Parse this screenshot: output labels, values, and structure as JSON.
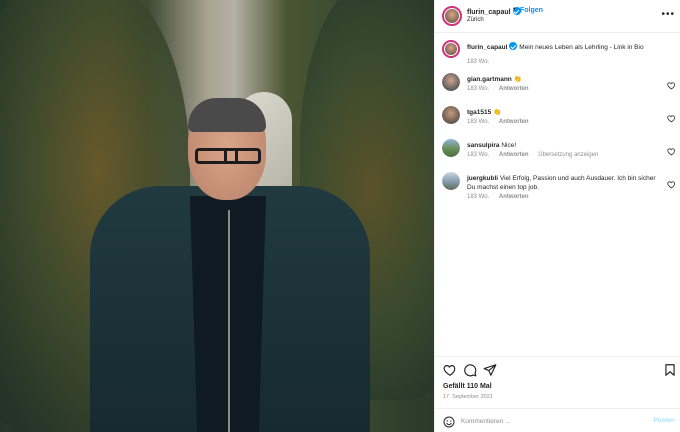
{
  "post": {
    "username": "flurin_capaul",
    "follow_label": "Folgen",
    "location": "Zürich",
    "more_icon": "more-horizontal-icon"
  },
  "caption": {
    "username": "flurin_capaul",
    "text": "Mein neues Leben als Lehrling - Link in Bio",
    "age": "183 Wo."
  },
  "comments": [
    {
      "username": "gian.gartmann",
      "text": "👏",
      "age": "183 Wo.",
      "reply": "Antworten",
      "translate": ""
    },
    {
      "username": "tga1515",
      "text": "👏",
      "age": "183 Wo.",
      "reply": "Antworten",
      "translate": ""
    },
    {
      "username": "sansulpira",
      "text": "Nice!",
      "age": "183 Wo.",
      "reply": "Antworten",
      "translate": "Übersetzung anzeigen"
    },
    {
      "username": "juergkubli",
      "text": "Viel Erfolg, Passion und auch Ausdauer. Ich bin sicher Du machst einen top job.",
      "age": "183 Wo.",
      "reply": "Antworten",
      "translate": ""
    }
  ],
  "stats": {
    "likes": "Gefällt 110 Mal",
    "date": "17. September 2021"
  },
  "composer": {
    "placeholder": "Kommentieren ...",
    "post_label": "Posten"
  },
  "colors": {
    "accent": "#0095f6",
    "ring": "#d3307d",
    "muted": "#8e8e8e",
    "post_disabled": "#b2dffc"
  }
}
